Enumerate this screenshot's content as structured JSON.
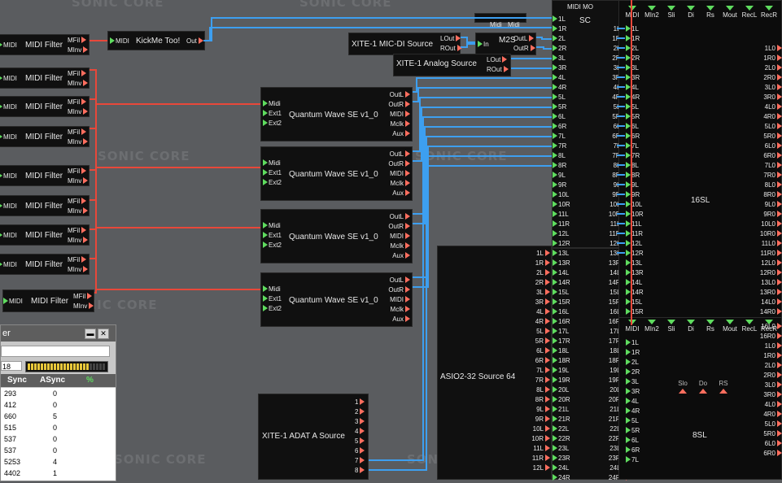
{
  "watermark": "SONIC CORE",
  "midi_filter": {
    "midi": "MIDI",
    "name": "MIDI Filter",
    "mfil": "MFil",
    "minv": "MInv"
  },
  "kickme": {
    "midi": "MIDI",
    "name": "KickMe Too!",
    "out": "Out"
  },
  "micdi": {
    "name": "XITE-1 MIC-DI Source",
    "lout": "LOut",
    "rout": "ROut"
  },
  "m2s": {
    "in": "In",
    "name": "M2S",
    "outl": "OutL",
    "outr": "OutR"
  },
  "analog": {
    "name": "XITE-1 Analog Source",
    "lout": "LOut",
    "rout": "ROut"
  },
  "qwave": {
    "name": "Quantum Wave SE v1_0",
    "inputs": [
      "Midi",
      "Ext1",
      "Ext2"
    ],
    "outputs": [
      "OutL",
      "OutR",
      "MIDI",
      "Mclk",
      "Aux"
    ]
  },
  "sc": {
    "top_labels": [
      "Midi",
      "Midi"
    ],
    "header": "MIDI  MO",
    "name": "SC",
    "inputs": [
      "1L",
      "1R",
      "2L",
      "2R",
      "3L",
      "3R",
      "4L",
      "4R",
      "5L",
      "5R",
      "6L",
      "6R",
      "7L",
      "7R",
      "8L",
      "8R",
      "9L",
      "9R",
      "10L",
      "10R",
      "11L",
      "11R",
      "12L",
      "12R"
    ],
    "outputs": [
      "1L0",
      "1R0",
      "2L0",
      "2R0",
      "3L0",
      "3R0",
      "4L0",
      "4R0",
      "5L0",
      "5R0",
      "6L0",
      "6R0",
      "7L0",
      "7R0",
      "8L0",
      "8R0",
      "9L0",
      "9R0",
      "10L0",
      "10R0",
      "11L0",
      "11R0",
      "12L0",
      "12R0"
    ]
  },
  "asio": {
    "name": "ASIO2-32 Source 64",
    "outputs": [
      "1L",
      "1R",
      "2L",
      "2R",
      "3L",
      "3R",
      "4L",
      "4R",
      "5L",
      "5R",
      "6L",
      "6R",
      "7L",
      "7R",
      "8L",
      "8R",
      "9L",
      "9R",
      "10L",
      "10R",
      "11L",
      "11R",
      "12L"
    ]
  },
  "asio_sc": {
    "inputs": [
      "13L",
      "13R",
      "14L",
      "14R",
      "15L",
      "15R",
      "16L",
      "16R",
      "17L",
      "17R",
      "18L",
      "18R",
      "19L",
      "19R",
      "20L",
      "20R",
      "21L",
      "21R",
      "22L",
      "22R",
      "23L",
      "23R",
      "24L",
      "24R"
    ],
    "outputs": [
      "13L0",
      "13R0",
      "14L0",
      "14R0",
      "15L0",
      "15R0",
      "16L0",
      "16R0",
      "17L0",
      "17R0",
      "18L0",
      "18R0",
      "19L0",
      "19R0",
      "20L0",
      "20R0",
      "21L0",
      "21R0",
      "22L0",
      "22R0",
      "23L0",
      "23R0",
      "24L0",
      "24R0"
    ]
  },
  "adat": {
    "name": "XITE-1 ADAT A Source",
    "outputs": [
      "1",
      "2",
      "3",
      "4",
      "5",
      "6",
      "7",
      "8"
    ]
  },
  "sl16": {
    "name": "16SL",
    "top": [
      "MIDI",
      "MIn2",
      "Sli",
      "Di",
      "Rs",
      "Mout",
      "RecL",
      "RecR"
    ],
    "bottom": [
      "MIDI",
      "MIn2",
      "Sli",
      "Di",
      "Rs",
      "Mout",
      "RecL",
      "RecR"
    ],
    "inputs": [
      "1L",
      "1R",
      "2L",
      "2R",
      "3L",
      "3R",
      "4L",
      "4R",
      "5L",
      "5R",
      "6L",
      "6R",
      "7L",
      "7R",
      "8L",
      "8R",
      "9L",
      "9R",
      "10L",
      "10R",
      "11L",
      "11R",
      "12L",
      "12R",
      "13L",
      "13R",
      "14L",
      "14R",
      "15L",
      "15R",
      "16L"
    ],
    "outputs": [
      "1L0",
      "1R0",
      "2L0",
      "2R0",
      "3L0",
      "3R0",
      "4L0",
      "4R0",
      "5L0",
      "5R0",
      "6L0",
      "6R0",
      "7L0",
      "7R0",
      "8L0",
      "8R0",
      "9L0",
      "9R0",
      "10L0",
      "10R0",
      "11L0",
      "11R0",
      "12L0",
      "12R0",
      "13L0",
      "13R0",
      "14L0",
      "14R0",
      "16R0"
    ]
  },
  "sl8": {
    "name": "8SL",
    "inputs": [
      "1L",
      "1R",
      "2L",
      "2R",
      "3L",
      "3R",
      "4L",
      "4R",
      "5L",
      "5R",
      "6L",
      "6R",
      "7L"
    ],
    "bottom": [
      "Slo",
      "Do",
      "RS"
    ],
    "outputs": [
      "16L0",
      "16R0",
      "1L0",
      "1R0",
      "2L0",
      "2R0",
      "3L0",
      "3R0",
      "4L0",
      "4R0",
      "5L0",
      "5R0",
      "6L0",
      "6R0"
    ]
  },
  "dsp_window": {
    "title": "er",
    "count": "18",
    "headers": [
      "Sync",
      "ASync",
      "%"
    ],
    "rows": [
      [
        "293",
        "0"
      ],
      [
        "412",
        "0"
      ],
      [
        "660",
        "5"
      ],
      [
        "515",
        "0"
      ],
      [
        "537",
        "0"
      ],
      [
        "537",
        "0"
      ],
      [
        "5253",
        "4"
      ],
      [
        "4402",
        "1"
      ]
    ]
  },
  "colors": {
    "wire_audio": "#3d9ff0",
    "wire_midi": "#e8483a",
    "pin_in": "#5fdc5f",
    "pin_out": "#ff6e5e"
  }
}
